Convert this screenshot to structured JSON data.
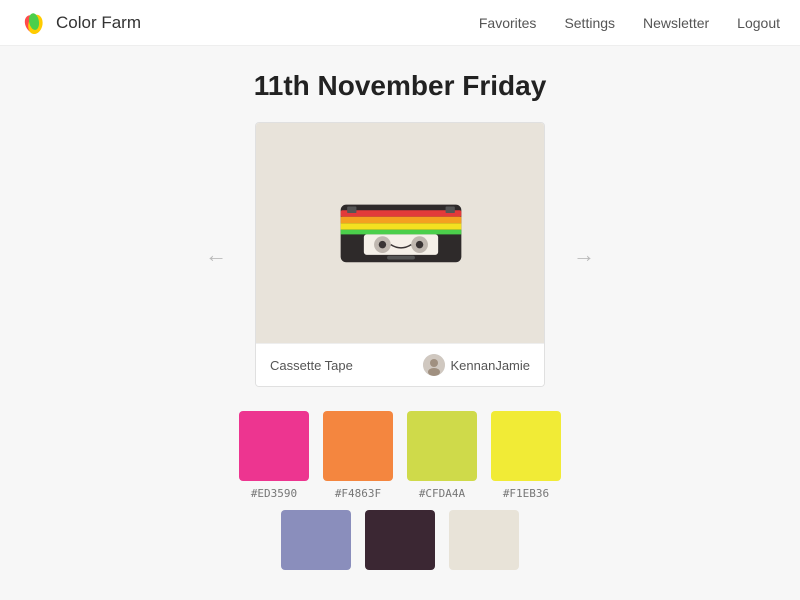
{
  "header": {
    "logo_text": "Color Farm",
    "nav": {
      "favorites": "Favorites",
      "settings": "Settings",
      "newsletter": "Newsletter",
      "logout": "Logout"
    }
  },
  "main": {
    "title": "11th November Friday",
    "card": {
      "name": "Cassette Tape",
      "author": "KennanJamie"
    },
    "arrows": {
      "left": "←",
      "right": "→"
    },
    "swatches_row1": [
      {
        "color": "#ED3590",
        "label": "#ED3590"
      },
      {
        "color": "#F4863F",
        "label": "#F4863F"
      },
      {
        "color": "#CFDA4A",
        "label": "#CFDA4A"
      },
      {
        "color": "#F1EB36",
        "label": "#F1EB36"
      }
    ],
    "swatches_row2": [
      {
        "color": "#8A8EBC",
        "label": ""
      },
      {
        "color": "#3B2733",
        "label": ""
      },
      {
        "color": "#E8E3D8",
        "label": ""
      }
    ]
  }
}
